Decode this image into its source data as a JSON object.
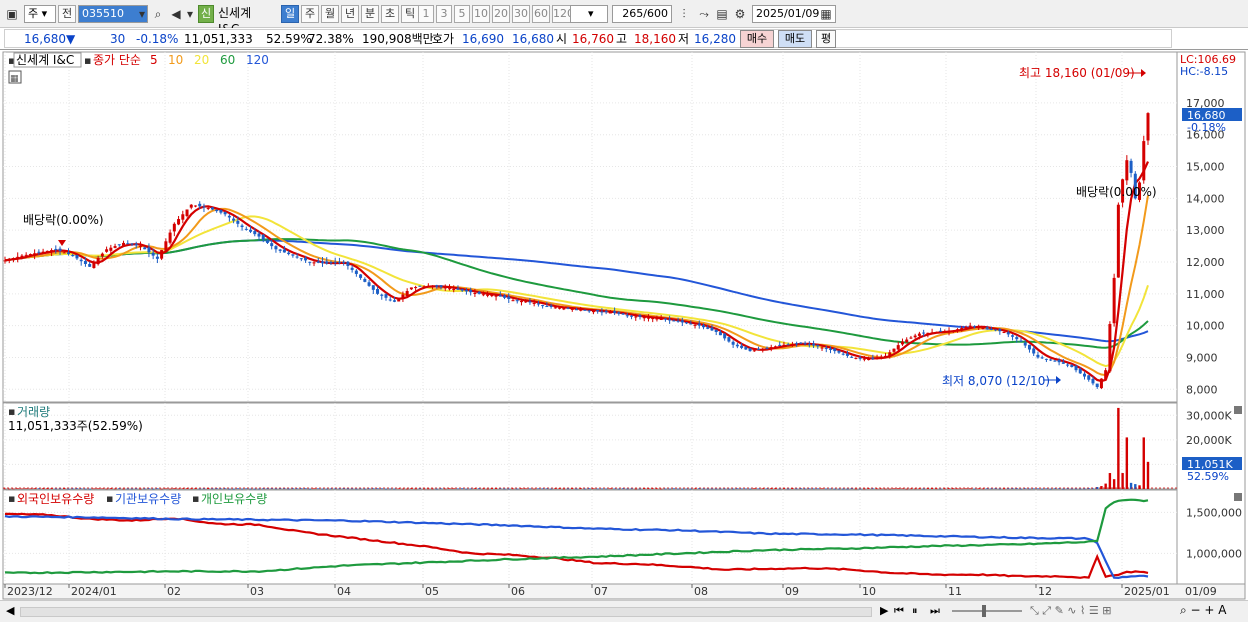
{
  "toolbar": {
    "mode_select": "주",
    "prev_label": "전",
    "code_value": "035510",
    "badge_label": "신",
    "stock_name": "신세계 I&C",
    "period_tabs": [
      "일",
      "주",
      "월",
      "년",
      "분",
      "초",
      "틱"
    ],
    "selected_period": "일",
    "interval_tabs": [
      "1",
      "3",
      "5",
      "10",
      "20",
      "30",
      "60",
      "120"
    ],
    "count_value": "265",
    "count_total": "/600",
    "date_value": "2025/01/09"
  },
  "quote": {
    "price": "16,680",
    "change_arrow": "▼",
    "change": "30",
    "change_pct": "-0.18%",
    "volume": "11,051,333",
    "turnover_pct": "52.59%",
    "other_pct": "72.38%",
    "amount": "190,908백만",
    "bid_label": "호가",
    "bid1": "16,690",
    "bid2": "16,680",
    "open_label": "시",
    "open": "16,760",
    "high_label": "고",
    "high": "18,160",
    "low_label": "저",
    "low": "16,280",
    "buy_label": "매수",
    "sell_label": "매도",
    "avg_label": "평"
  },
  "chart_data": [
    {
      "type": "candlestick",
      "title": "신세계 I&C",
      "legend": {
        "prefix": "종가 단순",
        "periods": [
          "5",
          "10",
          "20",
          "60",
          "120"
        ],
        "colors": [
          "#d40000",
          "#f29a1b",
          "#f2e43a",
          "#1e9a3e",
          "#2356d8"
        ]
      },
      "x_ticks": [
        "2023/12",
        "2024/01",
        "02",
        "03",
        "04",
        "05",
        "06",
        "07",
        "08",
        "09",
        "10",
        "11",
        "12",
        "2025/01"
      ],
      "y_ticks": [
        8000,
        9000,
        10000,
        11000,
        12000,
        13000,
        14000,
        15000,
        16000,
        17000
      ],
      "ylim": [
        7600,
        18600
      ],
      "right_axis_date": "01/09",
      "lc_label": "LC:106.69",
      "hc_label": "HC:-8.15",
      "current_price_label": "16,680",
      "current_change_label": "-0.18%",
      "annotations": {
        "high": "최고 18,160 (01/09)",
        "low": "최저 8,070 (12/10)",
        "dividend_left": "배당락(0.00%)",
        "dividend_right": "배당락(0.00%)"
      },
      "close_anchors": [
        [
          0,
          12050
        ],
        [
          4,
          12200
        ],
        [
          8,
          12300
        ],
        [
          12,
          12400
        ],
        [
          16,
          12200
        ],
        [
          20,
          11850
        ],
        [
          24,
          12400
        ],
        [
          28,
          12600
        ],
        [
          32,
          12500
        ],
        [
          36,
          12100
        ],
        [
          40,
          13200
        ],
        [
          44,
          13800
        ],
        [
          48,
          13700
        ],
        [
          52,
          13500
        ],
        [
          56,
          13100
        ],
        [
          60,
          12800
        ],
        [
          64,
          12400
        ],
        [
          68,
          12200
        ],
        [
          72,
          12000
        ],
        [
          76,
          11950
        ],
        [
          80,
          12000
        ],
        [
          84,
          11500
        ],
        [
          88,
          11000
        ],
        [
          92,
          10750
        ],
        [
          96,
          11200
        ],
        [
          100,
          11250
        ],
        [
          104,
          11200
        ],
        [
          108,
          11100
        ],
        [
          112,
          11000
        ],
        [
          116,
          10950
        ],
        [
          120,
          10800
        ],
        [
          124,
          10750
        ],
        [
          128,
          10600
        ],
        [
          132,
          10550
        ],
        [
          136,
          10500
        ],
        [
          140,
          10450
        ],
        [
          144,
          10400
        ],
        [
          148,
          10300
        ],
        [
          152,
          10250
        ],
        [
          156,
          10200
        ],
        [
          160,
          10100
        ],
        [
          164,
          10000
        ],
        [
          168,
          9800
        ],
        [
          172,
          9400
        ],
        [
          176,
          9200
        ],
        [
          180,
          9300
        ],
        [
          184,
          9400
        ],
        [
          188,
          9450
        ],
        [
          192,
          9350
        ],
        [
          196,
          9200
        ],
        [
          200,
          9000
        ],
        [
          204,
          8950
        ],
        [
          208,
          9050
        ],
        [
          212,
          9500
        ],
        [
          216,
          9750
        ],
        [
          220,
          9800
        ],
        [
          224,
          9850
        ],
        [
          228,
          10000
        ],
        [
          232,
          9900
        ],
        [
          236,
          9800
        ],
        [
          240,
          9500
        ],
        [
          244,
          9000
        ],
        [
          248,
          8900
        ],
        [
          252,
          8700
        ],
        [
          256,
          8300
        ],
        [
          258,
          8070
        ],
        [
          260,
          8600
        ],
        [
          262,
          11500
        ],
        [
          263,
          13800
        ],
        [
          264,
          14600
        ],
        [
          265,
          15200
        ],
        [
          266,
          14800
        ],
        [
          267,
          14000
        ],
        [
          268,
          14500
        ],
        [
          269,
          15800
        ],
        [
          270,
          16680
        ]
      ]
    },
    {
      "type": "bar",
      "title": "거래량",
      "current_label": "11,051,333주(52.59%)",
      "y_ticks": [
        "10,000K",
        "20,000K",
        "30,000K"
      ],
      "ylim": [
        0,
        35000
      ],
      "units": "K",
      "current_value_label": "11,051K",
      "current_pct_label": "52.59%",
      "recent_volumes": [
        [
          258,
          800
        ],
        [
          259,
          1200
        ],
        [
          260,
          2200
        ],
        [
          261,
          6500
        ],
        [
          262,
          4000
        ],
        [
          263,
          33000
        ],
        [
          264,
          6500
        ],
        [
          265,
          21000
        ],
        [
          266,
          2500
        ],
        [
          267,
          2000
        ],
        [
          268,
          1500
        ],
        [
          269,
          21000
        ],
        [
          270,
          11051
        ]
      ]
    },
    {
      "type": "line",
      "series": [
        {
          "name": "외국인보유수량",
          "color": "#d40000",
          "anchors": [
            [
              0,
              1480000
            ],
            [
              10,
              1470000
            ],
            [
              20,
              1420000
            ],
            [
              30,
              1400000
            ],
            [
              40,
              1430000
            ],
            [
              50,
              1360000
            ],
            [
              60,
              1350000
            ],
            [
              70,
              1260000
            ],
            [
              80,
              1200000
            ],
            [
              90,
              1140000
            ],
            [
              100,
              1080000
            ],
            [
              110,
              1000000
            ],
            [
              120,
              980000
            ],
            [
              130,
              940000
            ],
            [
              140,
              880000
            ],
            [
              150,
              870000
            ],
            [
              160,
              840000
            ],
            [
              170,
              800000
            ],
            [
              180,
              810000
            ],
            [
              190,
              820000
            ],
            [
              200,
              800000
            ],
            [
              210,
              760000
            ],
            [
              220,
              740000
            ],
            [
              230,
              740000
            ],
            [
              240,
              720000
            ],
            [
              250,
              720000
            ],
            [
              256,
              700000
            ],
            [
              258,
              960000
            ],
            [
              260,
              720000
            ],
            [
              262,
              730000
            ],
            [
              265,
              770000
            ],
            [
              268,
              780000
            ],
            [
              270,
              760000
            ]
          ]
        },
        {
          "name": "기관보유수량",
          "color": "#2356d8",
          "anchors": [
            [
              0,
              1450000
            ],
            [
              20,
              1440000
            ],
            [
              40,
              1420000
            ],
            [
              60,
              1410000
            ],
            [
              80,
              1400000
            ],
            [
              100,
              1370000
            ],
            [
              120,
              1340000
            ],
            [
              140,
              1300000
            ],
            [
              160,
              1280000
            ],
            [
              180,
              1240000
            ],
            [
              200,
              1230000
            ],
            [
              220,
              1210000
            ],
            [
              240,
              1190000
            ],
            [
              256,
              1180000
            ],
            [
              258,
              1130000
            ],
            [
              260,
              900000
            ],
            [
              262,
              700000
            ],
            [
              266,
              720000
            ],
            [
              270,
              720000
            ]
          ]
        },
        {
          "name": "개인보유수량",
          "color": "#1e9a3e",
          "anchors": [
            [
              0,
              760000
            ],
            [
              20,
              770000
            ],
            [
              40,
              780000
            ],
            [
              60,
              780000
            ],
            [
              80,
              850000
            ],
            [
              100,
              890000
            ],
            [
              120,
              930000
            ],
            [
              140,
              960000
            ],
            [
              160,
              1000000
            ],
            [
              180,
              1040000
            ],
            [
              200,
              1060000
            ],
            [
              220,
              1090000
            ],
            [
              240,
              1110000
            ],
            [
              256,
              1140000
            ],
            [
              258,
              1150000
            ],
            [
              260,
              1550000
            ],
            [
              262,
              1630000
            ],
            [
              266,
              1660000
            ],
            [
              270,
              1640000
            ]
          ]
        }
      ],
      "y_ticks": [
        "1,000,000",
        "1,500,000"
      ],
      "ylim": [
        650000,
        1700000
      ]
    }
  ]
}
